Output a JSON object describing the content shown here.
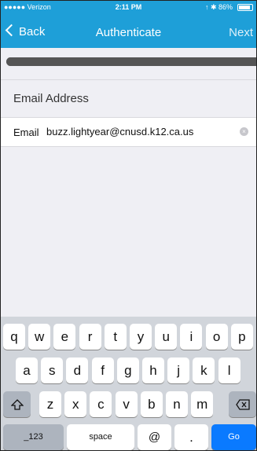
{
  "status": {
    "carrier": "●●●●● Verizon",
    "time": "2:11 PM",
    "right": "↑ ✱ 86%",
    "battery_level": 0.86
  },
  "nav": {
    "back": "Back",
    "title": "Authenticate",
    "next": "Next"
  },
  "progress": 1.0,
  "section": {
    "title": "Email Address"
  },
  "field": {
    "label": "Email",
    "value": "buzz.lightyear@cnusd.k12.ca.us"
  },
  "keyboard": {
    "row1": [
      "q",
      "w",
      "e",
      "r",
      "t",
      "y",
      "u",
      "i",
      "o",
      "p"
    ],
    "row2": [
      "a",
      "s",
      "d",
      "f",
      "g",
      "h",
      "j",
      "k",
      "l"
    ],
    "row3": [
      "z",
      "x",
      "c",
      "v",
      "b",
      "n",
      "m"
    ],
    "numbers": "_123",
    "space": "space",
    "at": "@",
    "dot": ".",
    "go": "Go",
    "shift_icon": "shift-icon",
    "backspace_icon": "backspace-icon"
  },
  "colors": {
    "accent": "#1e9fd8",
    "go": "#0a7aff"
  }
}
